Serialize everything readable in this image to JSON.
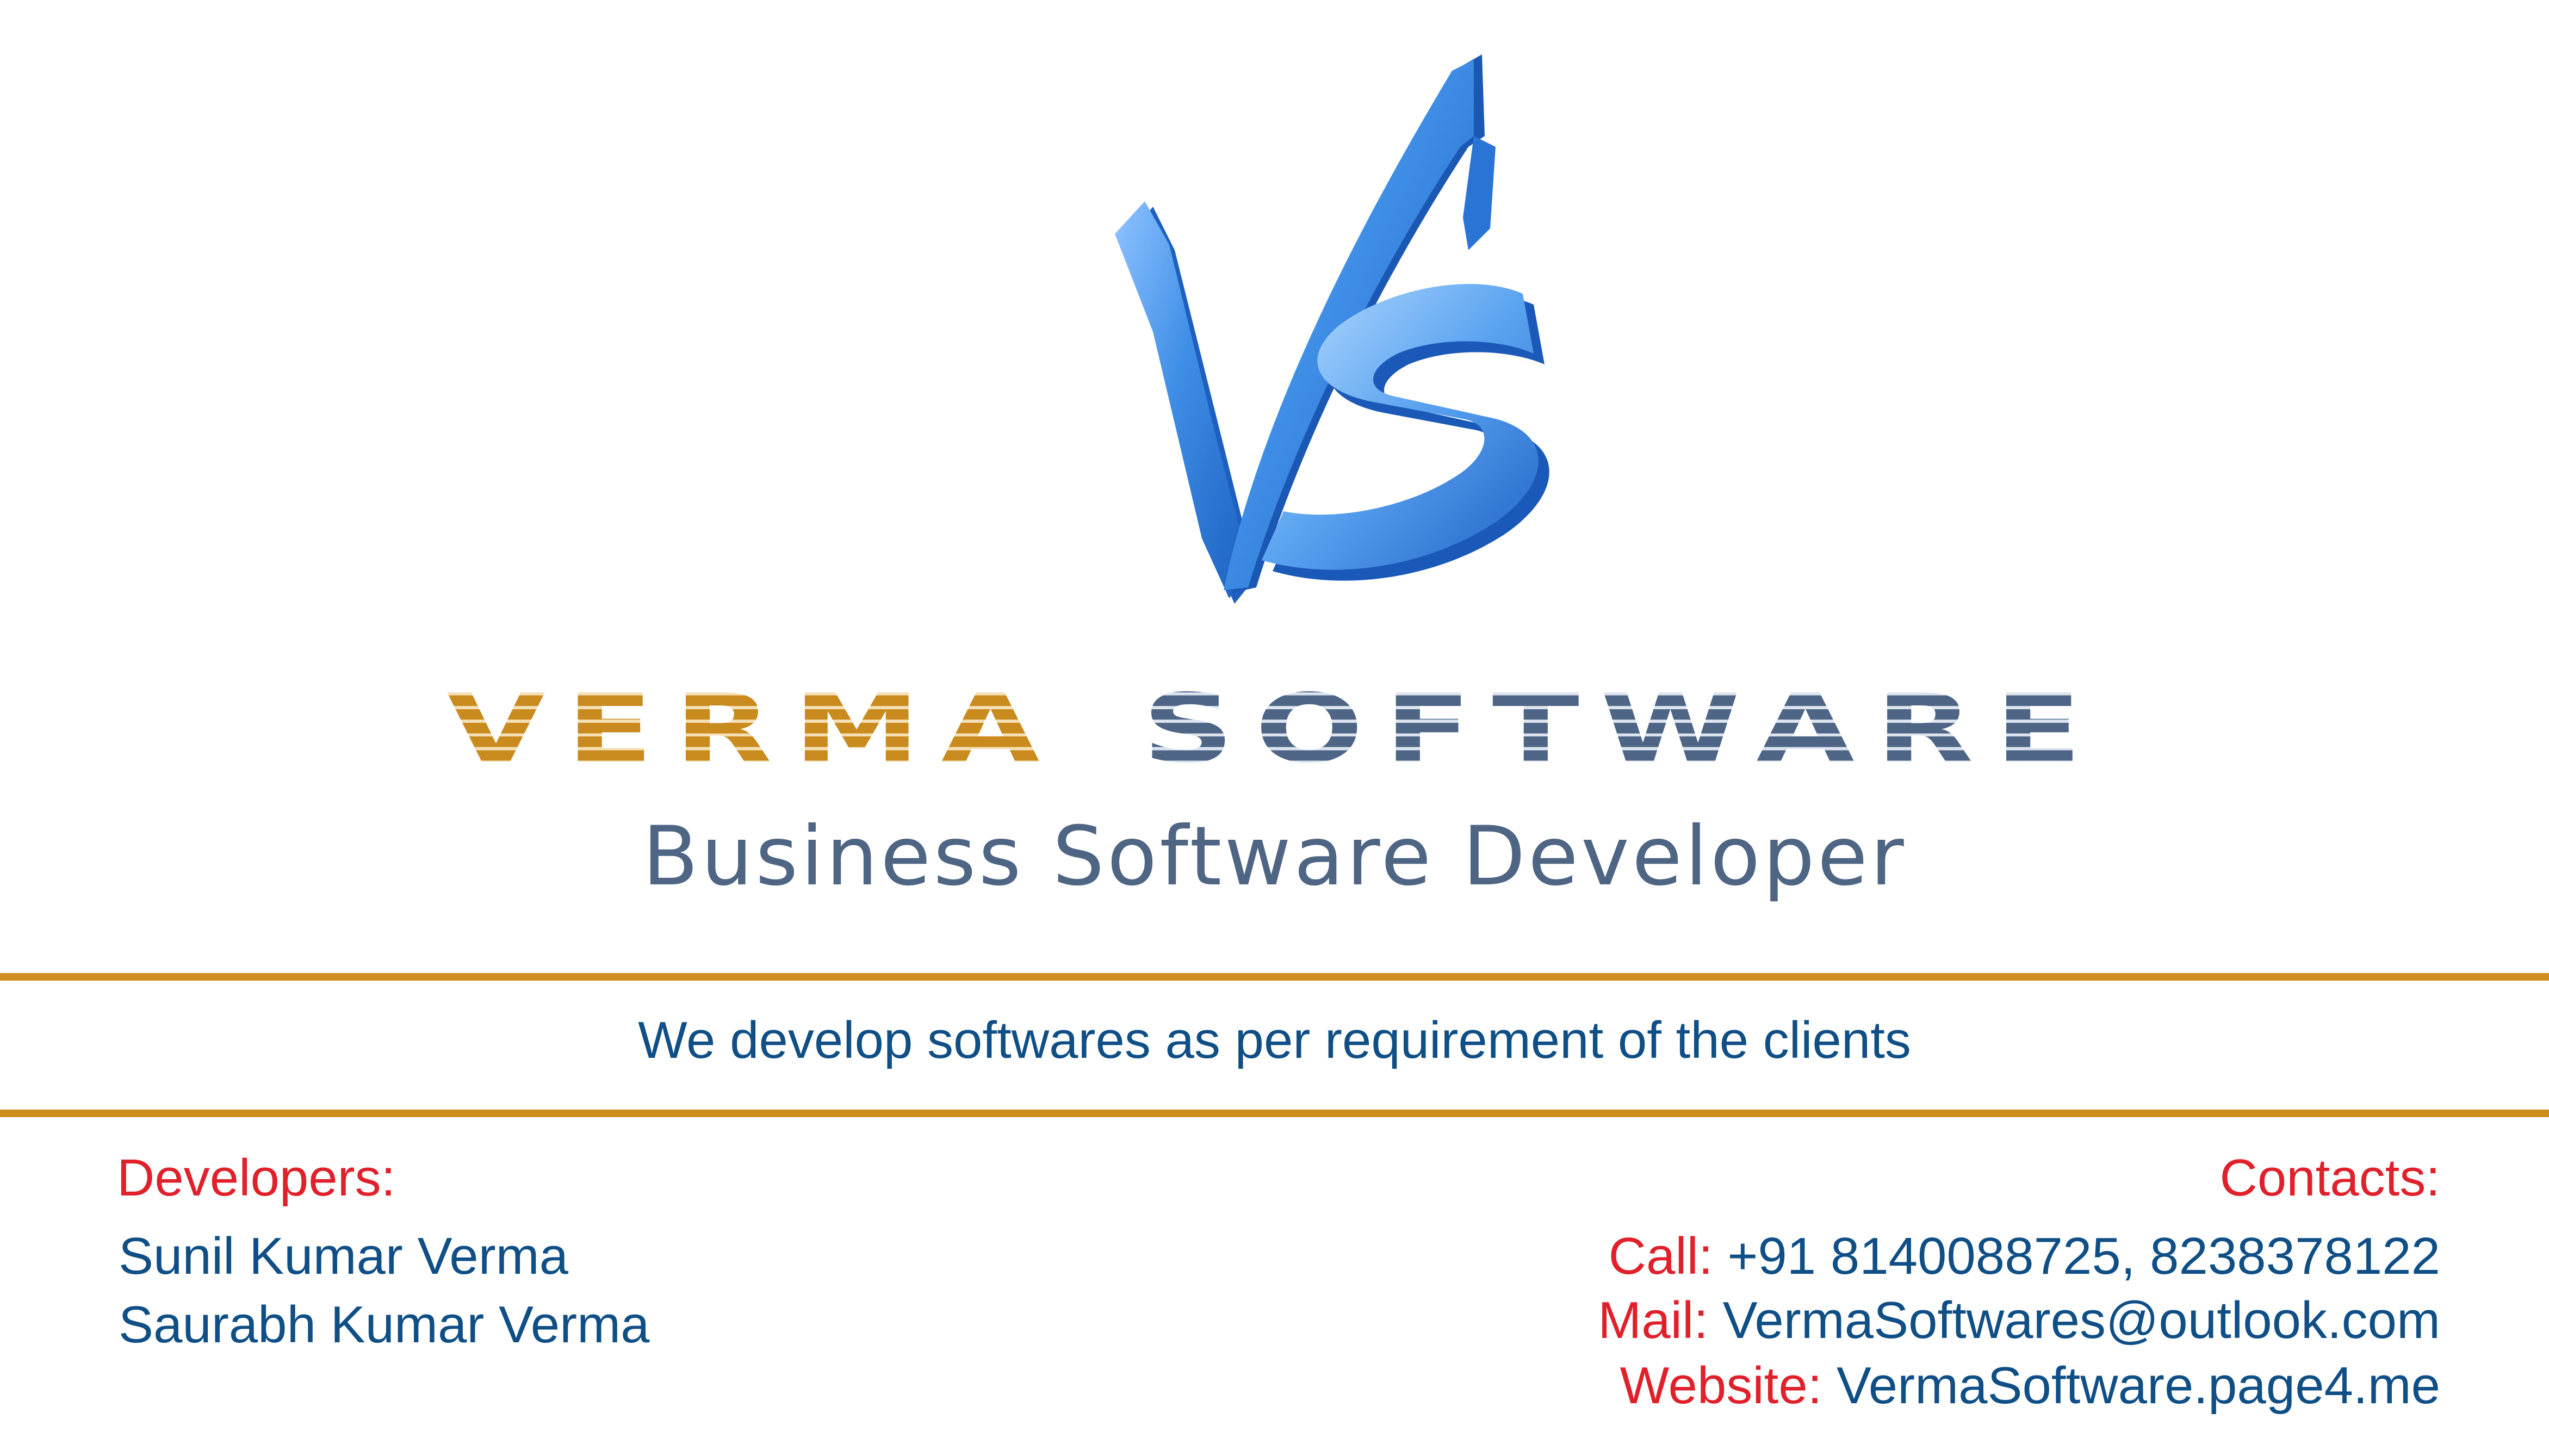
{
  "brand": {
    "word1": "VERMA",
    "word2": "SOFTWARE",
    "subtitle": "Business Software Developer",
    "logo_icon": "vs-monogram-logo"
  },
  "tagline": "We develop softwares as per requirement of the clients",
  "developers": {
    "heading": "Developers:",
    "names": [
      "Sunil Kumar Verma",
      "Saurabh Kumar Verma"
    ]
  },
  "contacts": {
    "heading": "Contacts:",
    "call_label": "Call:",
    "call_value": "+91 8140088725, 8238378122",
    "mail_label": "Mail:",
    "mail_value": "VermaSoftwares@outlook.com",
    "website_label": "Website:",
    "website_value": "VermaSoftware.page4.me"
  },
  "colors": {
    "gold": "#cf8d1f",
    "slate": "#4f6584",
    "blue_text": "#0f4f86",
    "red_label": "#e0202a",
    "logo_blue": "#3f8ee6"
  }
}
